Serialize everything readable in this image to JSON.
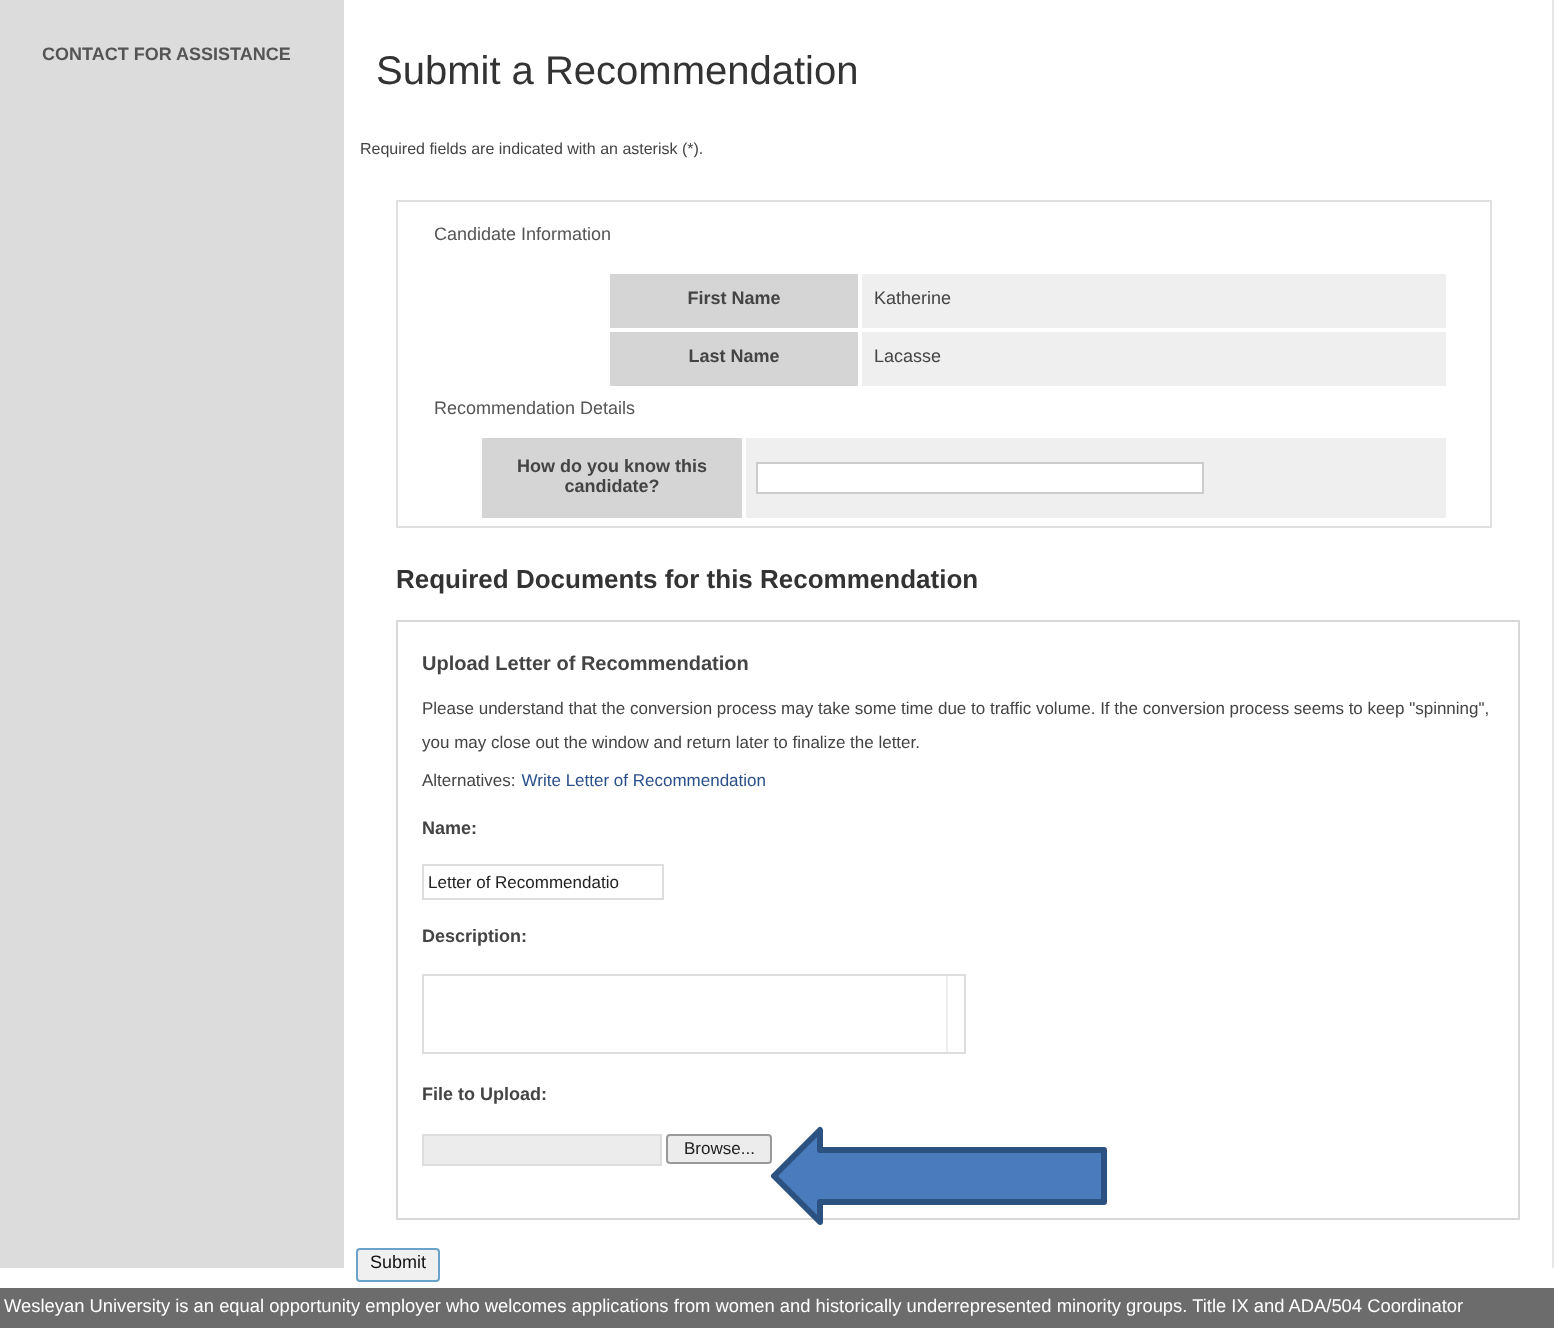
{
  "sidebar": {
    "heading": "CONTACT FOR ASSISTANCE"
  },
  "page": {
    "title": "Submit a Recommendation",
    "note": "Required fields are indicated with an asterisk (*)."
  },
  "candidate": {
    "heading": "Candidate Information",
    "rows": [
      {
        "label": "First Name",
        "value": "Katherine"
      },
      {
        "label": "Last Name",
        "value": "Lacasse"
      }
    ],
    "details_heading": "Recommendation Details",
    "question": {
      "label": "How do you know this candidate?"
    }
  },
  "documents": {
    "heading": "Required Documents for this Recommendation",
    "upload": {
      "heading": "Upload Letter of Recommendation",
      "paragraph": "Please understand that the conversion process may take some time due to traffic volume.  If the conversion process seems to keep \"spinning\", you may close out the window and return later to finalize the letter.",
      "alternatives_label": "Alternatives:",
      "alternatives_link": "Write Letter of Recommendation",
      "name_label": "Name:",
      "name_value": "Letter of Recommendatio",
      "description_label": "Description:",
      "file_label": "File to Upload:",
      "browse": "Browse..."
    }
  },
  "submit": "Submit",
  "footer": "Wesleyan University is an equal opportunity employer who welcomes applications from women and historically underrepresented minority groups. Title IX and ADA/504 Coordinator"
}
